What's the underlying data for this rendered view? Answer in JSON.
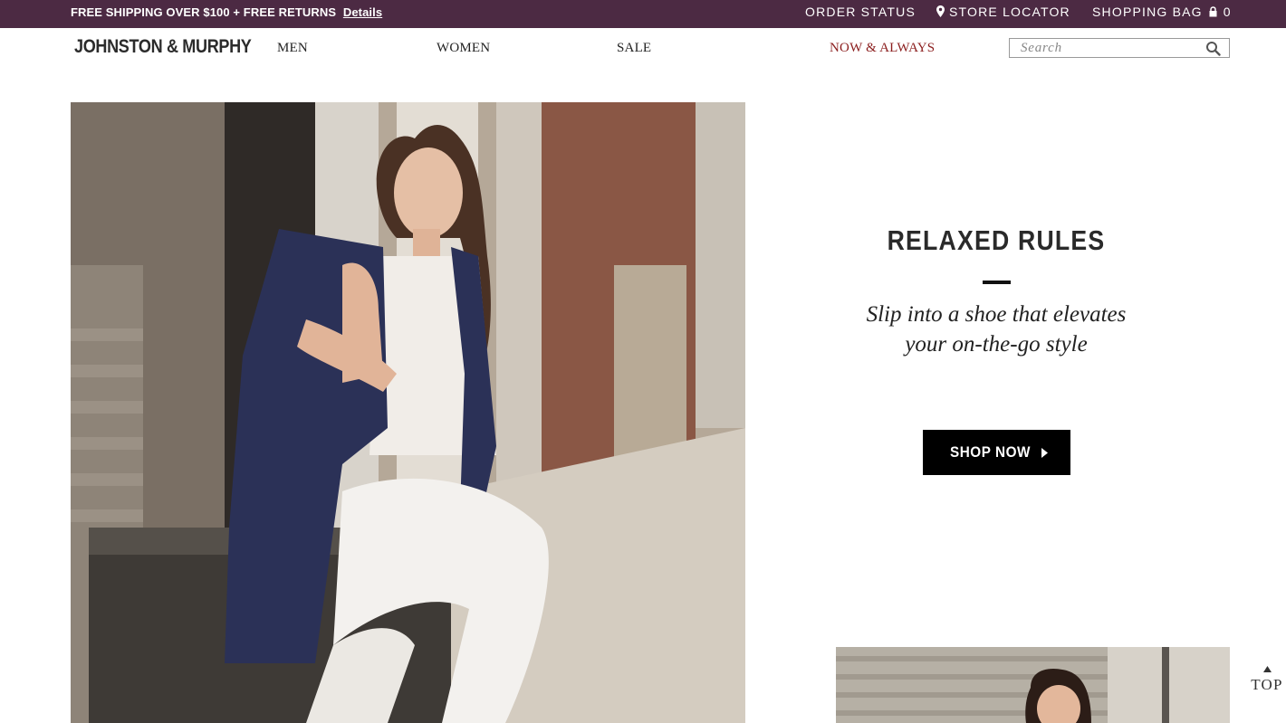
{
  "promo_bar": {
    "message": "FREE SHIPPING OVER $100 + FREE RETURNS",
    "details_link": "Details"
  },
  "utility_nav": {
    "order_status": "ORDER STATUS",
    "store_locator": "STORE LOCATOR",
    "shopping_bag": "SHOPPING BAG",
    "bag_count": "0",
    "icons": [
      "map-pin-icon",
      "lock-icon"
    ]
  },
  "header": {
    "logo": "JOHNSTON & MURPHY",
    "nav": [
      {
        "label": "MEN"
      },
      {
        "label": "WOMEN"
      },
      {
        "label": "SALE"
      },
      {
        "label": "NOW & ALWAYS",
        "color": "#8b1e1e"
      }
    ],
    "search": {
      "placeholder": "Search",
      "value": "",
      "icon": "search-icon"
    }
  },
  "promo": {
    "title": "RELAXED RULES",
    "subtitle_line1": "Slip into a shoe that elevates",
    "subtitle_line2": "your on-the-go style",
    "cta": "SHOP NOW",
    "cta_icon": "caret-right-icon"
  },
  "back_to_top": {
    "label": "TOP",
    "icon": "caret-up-icon"
  },
  "colors": {
    "promo_bar_bg": "#4c2a43",
    "accent_red": "#8b1e1e",
    "cta_bg": "#000000",
    "text": "#222222"
  }
}
